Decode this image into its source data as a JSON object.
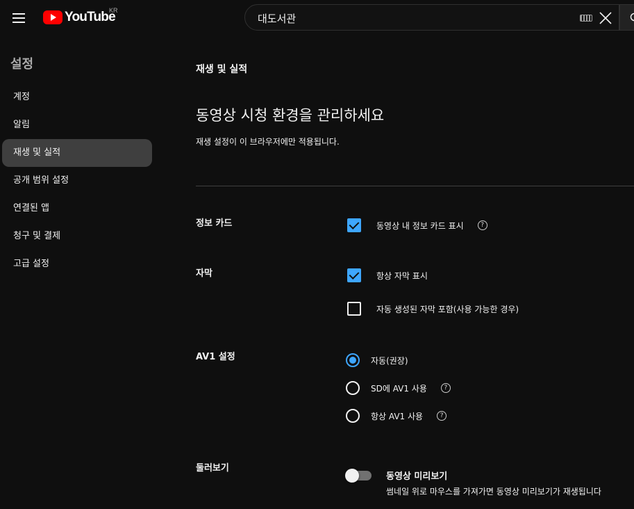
{
  "header": {
    "logo_text": "YouTube",
    "region": "KR",
    "search_value": "대도서관"
  },
  "sidebar": {
    "title": "설정",
    "items": [
      {
        "label": "계정"
      },
      {
        "label": "알림"
      },
      {
        "label": "재생 및 실적"
      },
      {
        "label": "공개 범위 설정"
      },
      {
        "label": "연결된 앱"
      },
      {
        "label": "청구 및 결제"
      },
      {
        "label": "고급 설정"
      }
    ],
    "active_index": 2
  },
  "main": {
    "section": "재생 및 실적",
    "title": "동영상 시청 환경을 관리하세요",
    "subtitle": "재생 설정이 이 브라우저에만 적용됩니다.",
    "info_cards": {
      "label": "정보 카드",
      "option": "동영상 내 정보 카드 표시",
      "checked": true
    },
    "captions": {
      "label": "자막",
      "options": [
        {
          "label": "항상 자막 표시",
          "checked": true
        },
        {
          "label": "자동 생성된 자막 포함(사용 가능한 경우)",
          "checked": false
        }
      ]
    },
    "av1": {
      "label": "AV1 설정",
      "options": [
        {
          "label": "자동(권장)",
          "selected": true
        },
        {
          "label": "SD에 AV1 사용",
          "selected": false
        },
        {
          "label": "항상 AV1 사용",
          "selected": false
        }
      ]
    },
    "browse": {
      "label": "둘러보기",
      "toggle_title": "동영상 미리보기",
      "toggle_desc": "썸네일 위로 마우스를 가져가면 동영상 미리보기가 재생됩니다",
      "enabled": false
    },
    "help_glyph": "?"
  },
  "colors": {
    "background": "#0f0f0f",
    "accent": "#3ea6ff",
    "brand": "#ff0000",
    "sidebar_active": "#3f3f3f"
  }
}
